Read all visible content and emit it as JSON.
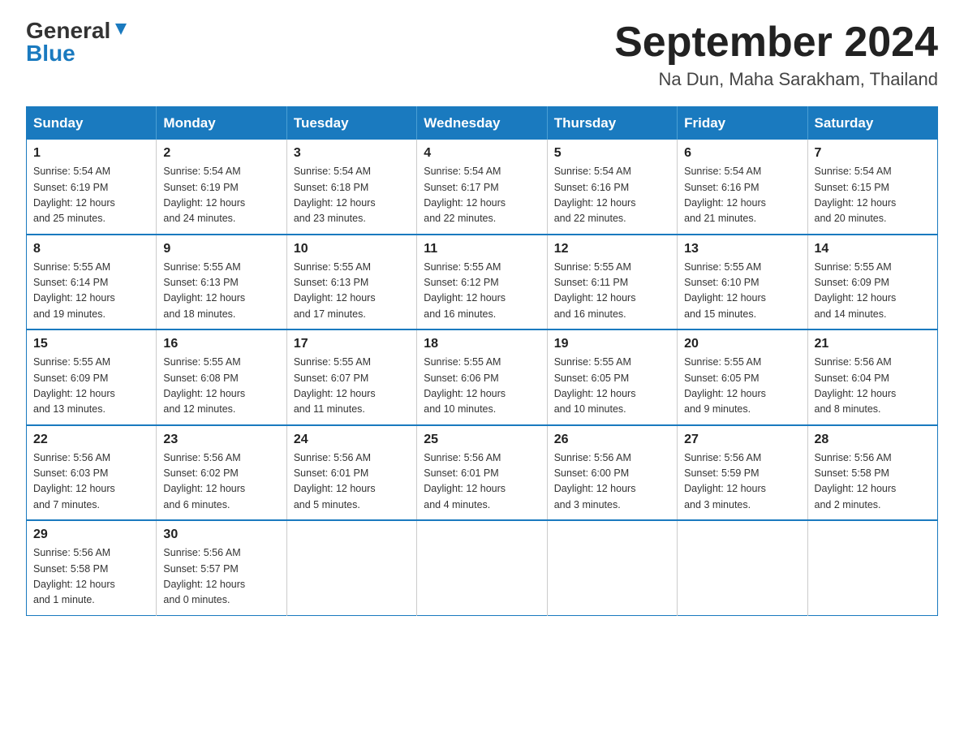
{
  "logo": {
    "general": "General",
    "blue": "Blue"
  },
  "title": {
    "month_year": "September 2024",
    "location": "Na Dun, Maha Sarakham, Thailand"
  },
  "weekdays": [
    "Sunday",
    "Monday",
    "Tuesday",
    "Wednesday",
    "Thursday",
    "Friday",
    "Saturday"
  ],
  "weeks": [
    [
      {
        "day": "1",
        "sunrise": "5:54 AM",
        "sunset": "6:19 PM",
        "daylight": "12 hours and 25 minutes."
      },
      {
        "day": "2",
        "sunrise": "5:54 AM",
        "sunset": "6:19 PM",
        "daylight": "12 hours and 24 minutes."
      },
      {
        "day": "3",
        "sunrise": "5:54 AM",
        "sunset": "6:18 PM",
        "daylight": "12 hours and 23 minutes."
      },
      {
        "day": "4",
        "sunrise": "5:54 AM",
        "sunset": "6:17 PM",
        "daylight": "12 hours and 22 minutes."
      },
      {
        "day": "5",
        "sunrise": "5:54 AM",
        "sunset": "6:16 PM",
        "daylight": "12 hours and 22 minutes."
      },
      {
        "day": "6",
        "sunrise": "5:54 AM",
        "sunset": "6:16 PM",
        "daylight": "12 hours and 21 minutes."
      },
      {
        "day": "7",
        "sunrise": "5:54 AM",
        "sunset": "6:15 PM",
        "daylight": "12 hours and 20 minutes."
      }
    ],
    [
      {
        "day": "8",
        "sunrise": "5:55 AM",
        "sunset": "6:14 PM",
        "daylight": "12 hours and 19 minutes."
      },
      {
        "day": "9",
        "sunrise": "5:55 AM",
        "sunset": "6:13 PM",
        "daylight": "12 hours and 18 minutes."
      },
      {
        "day": "10",
        "sunrise": "5:55 AM",
        "sunset": "6:13 PM",
        "daylight": "12 hours and 17 minutes."
      },
      {
        "day": "11",
        "sunrise": "5:55 AM",
        "sunset": "6:12 PM",
        "daylight": "12 hours and 16 minutes."
      },
      {
        "day": "12",
        "sunrise": "5:55 AM",
        "sunset": "6:11 PM",
        "daylight": "12 hours and 16 minutes."
      },
      {
        "day": "13",
        "sunrise": "5:55 AM",
        "sunset": "6:10 PM",
        "daylight": "12 hours and 15 minutes."
      },
      {
        "day": "14",
        "sunrise": "5:55 AM",
        "sunset": "6:09 PM",
        "daylight": "12 hours and 14 minutes."
      }
    ],
    [
      {
        "day": "15",
        "sunrise": "5:55 AM",
        "sunset": "6:09 PM",
        "daylight": "12 hours and 13 minutes."
      },
      {
        "day": "16",
        "sunrise": "5:55 AM",
        "sunset": "6:08 PM",
        "daylight": "12 hours and 12 minutes."
      },
      {
        "day": "17",
        "sunrise": "5:55 AM",
        "sunset": "6:07 PM",
        "daylight": "12 hours and 11 minutes."
      },
      {
        "day": "18",
        "sunrise": "5:55 AM",
        "sunset": "6:06 PM",
        "daylight": "12 hours and 10 minutes."
      },
      {
        "day": "19",
        "sunrise": "5:55 AM",
        "sunset": "6:05 PM",
        "daylight": "12 hours and 10 minutes."
      },
      {
        "day": "20",
        "sunrise": "5:55 AM",
        "sunset": "6:05 PM",
        "daylight": "12 hours and 9 minutes."
      },
      {
        "day": "21",
        "sunrise": "5:56 AM",
        "sunset": "6:04 PM",
        "daylight": "12 hours and 8 minutes."
      }
    ],
    [
      {
        "day": "22",
        "sunrise": "5:56 AM",
        "sunset": "6:03 PM",
        "daylight": "12 hours and 7 minutes."
      },
      {
        "day": "23",
        "sunrise": "5:56 AM",
        "sunset": "6:02 PM",
        "daylight": "12 hours and 6 minutes."
      },
      {
        "day": "24",
        "sunrise": "5:56 AM",
        "sunset": "6:01 PM",
        "daylight": "12 hours and 5 minutes."
      },
      {
        "day": "25",
        "sunrise": "5:56 AM",
        "sunset": "6:01 PM",
        "daylight": "12 hours and 4 minutes."
      },
      {
        "day": "26",
        "sunrise": "5:56 AM",
        "sunset": "6:00 PM",
        "daylight": "12 hours and 3 minutes."
      },
      {
        "day": "27",
        "sunrise": "5:56 AM",
        "sunset": "5:59 PM",
        "daylight": "12 hours and 3 minutes."
      },
      {
        "day": "28",
        "sunrise": "5:56 AM",
        "sunset": "5:58 PM",
        "daylight": "12 hours and 2 minutes."
      }
    ],
    [
      {
        "day": "29",
        "sunrise": "5:56 AM",
        "sunset": "5:58 PM",
        "daylight": "12 hours and 1 minute."
      },
      {
        "day": "30",
        "sunrise": "5:56 AM",
        "sunset": "5:57 PM",
        "daylight": "12 hours and 0 minutes."
      },
      null,
      null,
      null,
      null,
      null
    ]
  ],
  "labels": {
    "sunrise": "Sunrise:",
    "sunset": "Sunset:",
    "daylight": "Daylight:"
  }
}
